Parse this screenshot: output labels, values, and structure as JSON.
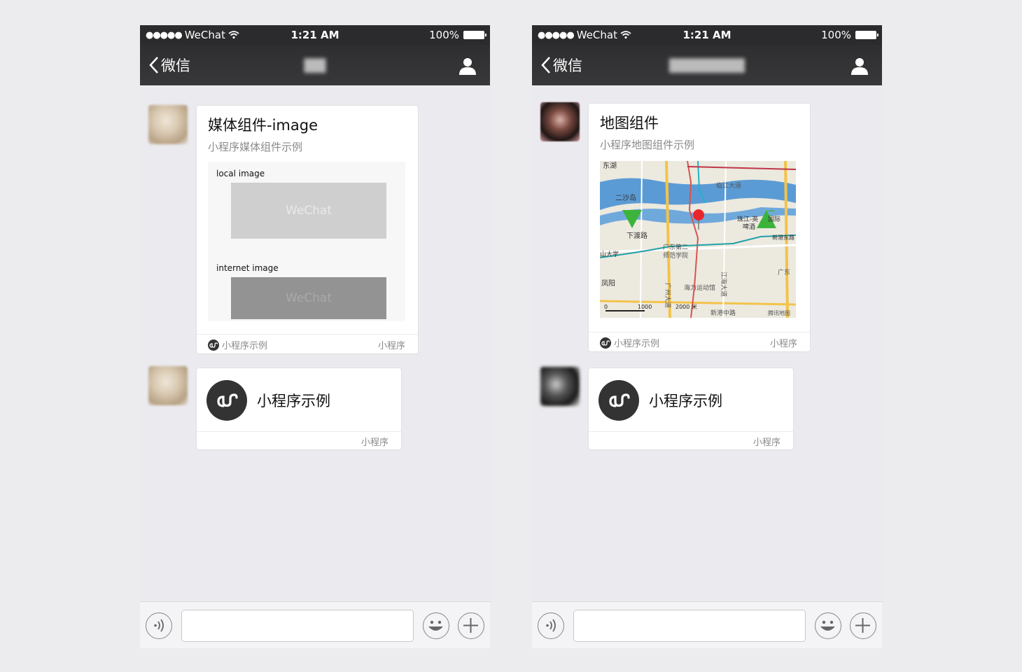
{
  "status_bar": {
    "carrier": "WeChat",
    "time": "1:21 AM",
    "battery": "100%"
  },
  "nav": {
    "back_label": "微信"
  },
  "left": {
    "card": {
      "title": "媒体组件-image",
      "subtitle": "小程序媒体组件示例",
      "local_label": "local image",
      "internet_label": "internet image",
      "image_text": "WeChat",
      "footer_source": "小程序示例",
      "footer_type": "小程序"
    },
    "mini_program": {
      "name": "小程序示例",
      "footer": "小程序"
    }
  },
  "right": {
    "card": {
      "title": "地图组件",
      "subtitle": "小程序地图组件示例",
      "footer_source": "小程序示例",
      "footer_type": "小程序"
    },
    "map_labels": {
      "l1": "东湖",
      "l2": "二沙岛",
      "l3": "下渡路",
      "l4": "山大学",
      "l5": "凤阳",
      "l6": "广东第二",
      "l7": "师范学院",
      "l8": "临江大道",
      "l9": "珠江-英",
      "l10": "啤酒",
      "l11": "国际",
      "l12": "新港东路",
      "l13": "广东",
      "l14": "海力运动馆",
      "l15": "广州大道",
      "l16": "江海大道",
      "l17": "新港中路",
      "l18": "腾讯地图",
      "s0": "0",
      "s1": "1000",
      "s2": "2000 米"
    },
    "mini_program": {
      "name": "小程序示例",
      "footer": "小程序"
    }
  },
  "colors": {
    "status_bg": "#2b2b2d",
    "nav_bg": "#353537",
    "chat_bg": "#ebebef",
    "river": "#5b9bd5",
    "marker_red": "#e8262b",
    "marker_green": "#3cb43c"
  },
  "icons": [
    "wifi-icon",
    "battery-icon",
    "back-chevron-icon",
    "contact-icon",
    "mini-program-icon",
    "voice-icon",
    "emoji-icon",
    "plus-icon"
  ]
}
